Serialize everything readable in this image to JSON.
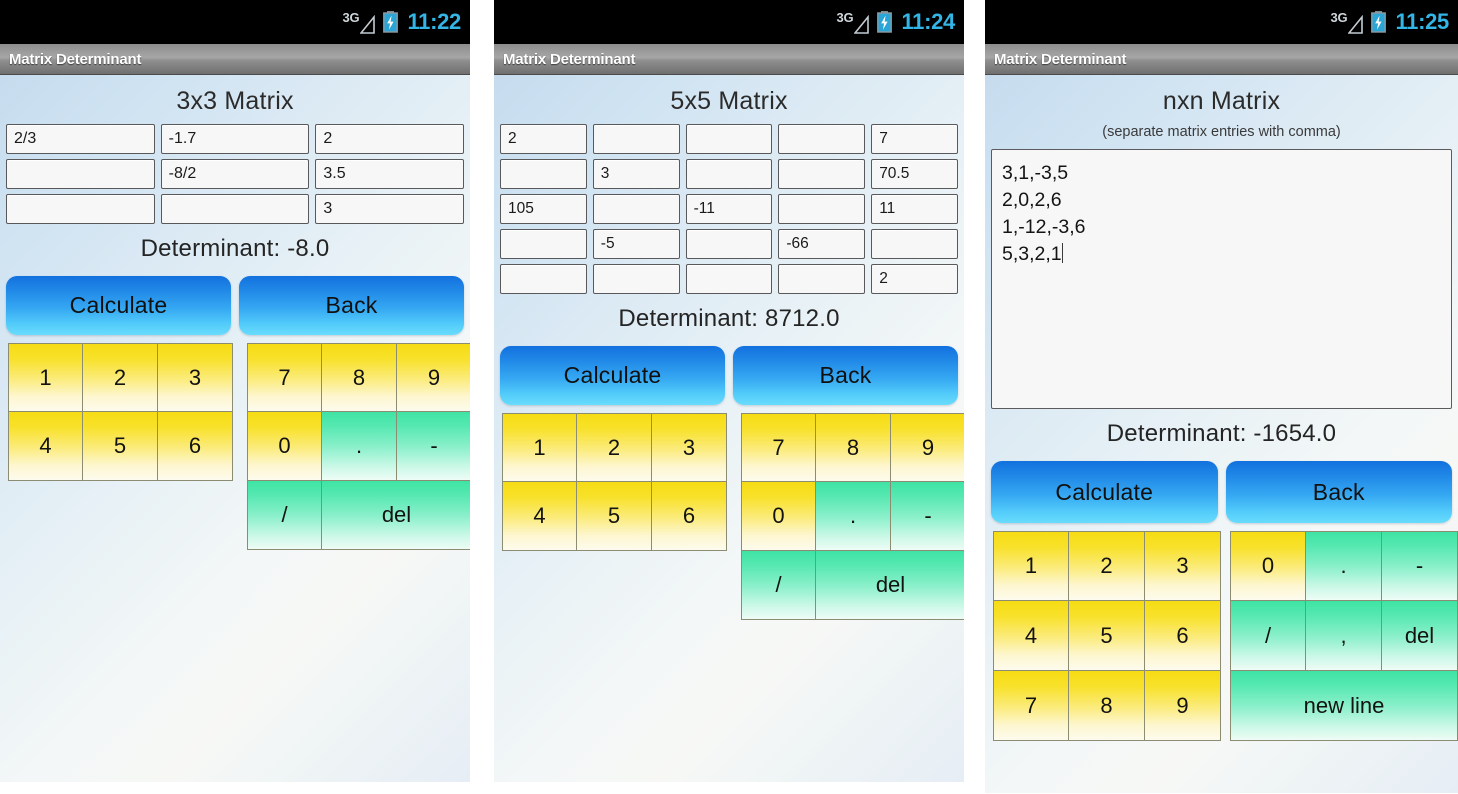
{
  "app": {
    "title": "Matrix Determinant",
    "accent_blue": "#1f86e6",
    "key_yellow": "#f6dc14",
    "key_green": "#3fe3a4",
    "background_top": "#c6dcee",
    "background_bottom": "#f7f8f6",
    "clock_color": "#33b5e5"
  },
  "icons": {
    "signal": "signal-3g-icon",
    "battery": "battery-charging-icon"
  },
  "panels": [
    {
      "id": "panel-3x3",
      "status": {
        "network": "3G",
        "clock": "11:22"
      },
      "screen_title": "3x3 Matrix",
      "subtitle": "",
      "matrix": {
        "size": "3x3",
        "rows": [
          [
            "2/3",
            "-1.7",
            "2"
          ],
          [
            "",
            "-8/2",
            "3.5"
          ],
          [
            "",
            "",
            "3"
          ]
        ]
      },
      "determinant": "Determinant: -8.0",
      "buttons": {
        "calculate": "Calculate",
        "back": "Back"
      },
      "keypad": {
        "left": [
          [
            "1",
            "2",
            "3"
          ],
          [
            "4",
            "5",
            "6"
          ]
        ],
        "right_rows": [
          [
            {
              "label": "7",
              "type": "num",
              "span": 1
            },
            {
              "label": "8",
              "type": "num",
              "span": 1
            },
            {
              "label": "9",
              "type": "num",
              "span": 1
            }
          ],
          [
            {
              "label": "0",
              "type": "num",
              "span": 1
            },
            {
              "label": ".",
              "type": "op",
              "span": 1
            },
            {
              "label": "-",
              "type": "op",
              "span": 1
            }
          ],
          [
            {
              "label": "/",
              "type": "op",
              "span": 1
            },
            {
              "label": "del",
              "type": "op",
              "span": 2
            }
          ]
        ]
      }
    },
    {
      "id": "panel-5x5",
      "status": {
        "network": "3G",
        "clock": "11:24"
      },
      "screen_title": "5x5 Matrix",
      "subtitle": "",
      "matrix": {
        "size": "5x5",
        "rows": [
          [
            "2",
            "",
            "",
            "",
            "7"
          ],
          [
            "",
            "3",
            "",
            "",
            "70.5"
          ],
          [
            "105",
            "",
            "-11",
            "",
            "11"
          ],
          [
            "",
            "-5",
            "",
            "-66",
            ""
          ],
          [
            "",
            "",
            "",
            "",
            "2"
          ]
        ]
      },
      "determinant": "Determinant: 8712.0",
      "buttons": {
        "calculate": "Calculate",
        "back": "Back"
      },
      "keypad": {
        "left": [
          [
            "1",
            "2",
            "3"
          ],
          [
            "4",
            "5",
            "6"
          ]
        ],
        "right_rows": [
          [
            {
              "label": "7",
              "type": "num",
              "span": 1
            },
            {
              "label": "8",
              "type": "num",
              "span": 1
            },
            {
              "label": "9",
              "type": "num",
              "span": 1
            }
          ],
          [
            {
              "label": "0",
              "type": "num",
              "span": 1
            },
            {
              "label": ".",
              "type": "op",
              "span": 1
            },
            {
              "label": "-",
              "type": "op",
              "span": 1
            }
          ],
          [
            {
              "label": "/",
              "type": "op",
              "span": 1
            },
            {
              "label": "del",
              "type": "op",
              "span": 2
            }
          ]
        ]
      }
    },
    {
      "id": "panel-nxn",
      "status": {
        "network": "3G",
        "clock": "11:25"
      },
      "screen_title": "nxn Matrix",
      "subtitle": "(separate matrix entries with comma)",
      "textarea": {
        "value": "3,1,-3,5\n2,0,2,6\n1,-12,-3,6\n5,3,2,1",
        "placeholder": ""
      },
      "determinant": "Determinant: -1654.0",
      "buttons": {
        "calculate": "Calculate",
        "back": "Back"
      },
      "keypad": {
        "left": [
          [
            "1",
            "2",
            "3"
          ],
          [
            "4",
            "5",
            "6"
          ],
          [
            "7",
            "8",
            "9"
          ]
        ],
        "right_rows": [
          [
            {
              "label": "0",
              "type": "num",
              "span": 1
            },
            {
              "label": ".",
              "type": "op",
              "span": 1
            },
            {
              "label": "-",
              "type": "op",
              "span": 1
            }
          ],
          [
            {
              "label": "/",
              "type": "op",
              "span": 1
            },
            {
              "label": ",",
              "type": "op",
              "span": 1
            },
            {
              "label": "del",
              "type": "op",
              "span": 1
            }
          ],
          [
            {
              "label": "new line",
              "type": "op",
              "span": 3
            }
          ]
        ]
      }
    }
  ]
}
